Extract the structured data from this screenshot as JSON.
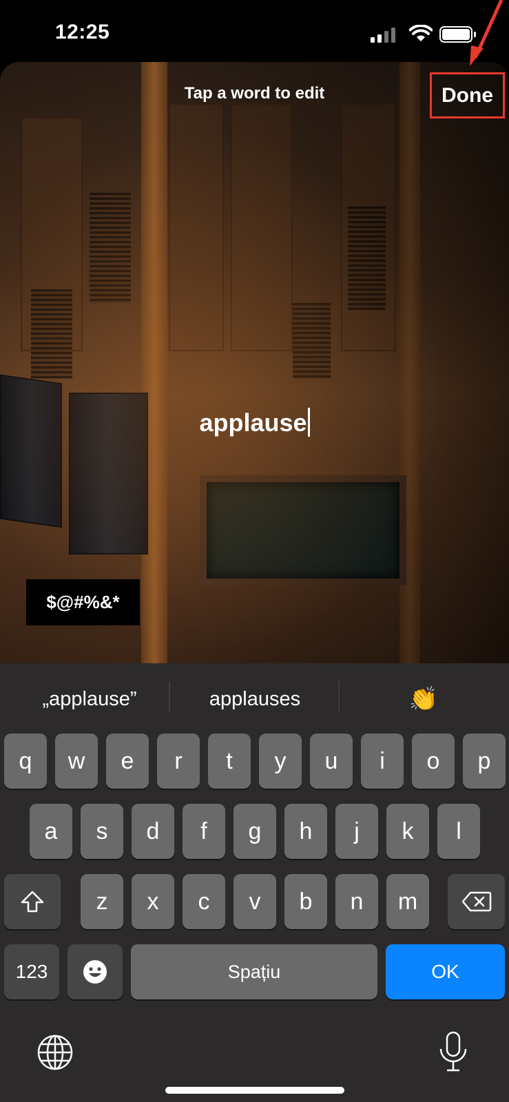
{
  "status_bar": {
    "time": "12:25"
  },
  "editor": {
    "hint": "Tap a word to edit",
    "done_label": "Done",
    "edit_word": "applause",
    "symbol_chip": "$@#%&*",
    "highlight_color": "#e8392d"
  },
  "keyboard": {
    "suggestions": [
      "„applause”",
      "applauses",
      "👏"
    ],
    "rows": [
      [
        "q",
        "w",
        "e",
        "r",
        "t",
        "y",
        "u",
        "i",
        "o",
        "p"
      ],
      [
        "a",
        "s",
        "d",
        "f",
        "g",
        "h",
        "j",
        "k",
        "l"
      ],
      [
        "z",
        "x",
        "c",
        "v",
        "b",
        "n",
        "m"
      ]
    ],
    "numbers_label": "123",
    "space_label": "Spațiu",
    "ok_label": "OK",
    "accent": "#0a84ff"
  }
}
